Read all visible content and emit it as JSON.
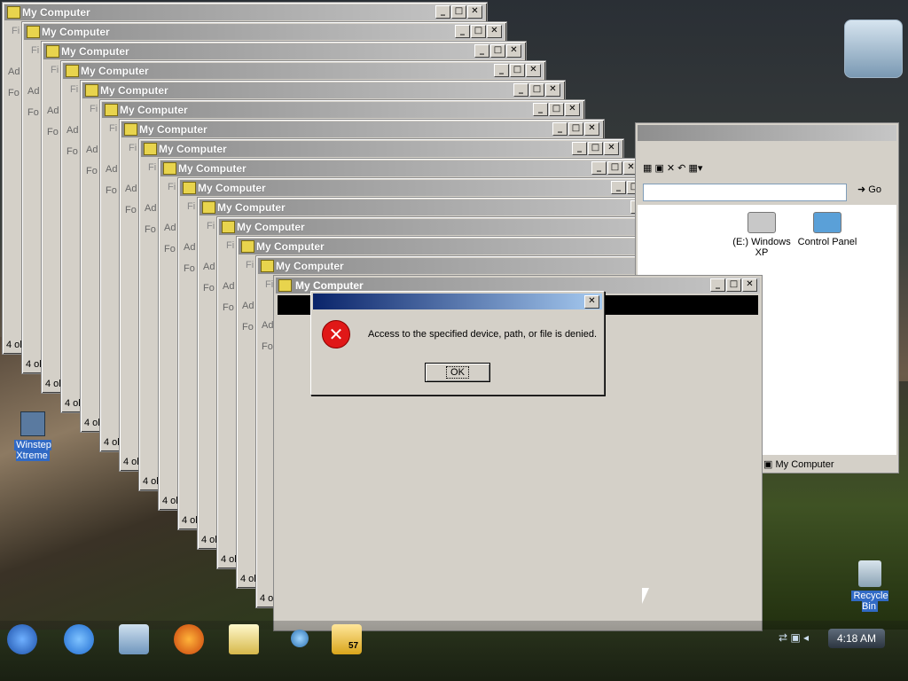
{
  "window_title": "My Computer",
  "menu_fragment": "Fi",
  "address_fragment": "Ad",
  "folders_fragment": "Fo",
  "status_fragment": "4 ol",
  "controls": {
    "minimize": "_",
    "maximize": "□",
    "close": "✕"
  },
  "explorer": {
    "go_label": "Go",
    "status_text": "My Computer",
    "items": [
      {
        "label": "(E:) Windows XP",
        "icon": "drive-icon"
      },
      {
        "label": "Control Panel",
        "icon": "control-panel-icon"
      }
    ]
  },
  "dialog": {
    "message": "Access to the specified device, path, or file is denied.",
    "ok_label": "OK",
    "icon": "error-icon"
  },
  "desktop_icons": [
    {
      "label": "Winstep Xtreme",
      "icon": "winstep-icon"
    },
    {
      "label": "Recycle Bin",
      "icon": "recycle-bin-icon"
    }
  ],
  "taskbar": {
    "time": "4:18 AM",
    "active_count": "57",
    "items": [
      "start-orb-icon",
      "internet-explorer-icon",
      "network-icon",
      "firefox-icon",
      "notepad-icon",
      "media-icon",
      "folder-icon"
    ]
  }
}
